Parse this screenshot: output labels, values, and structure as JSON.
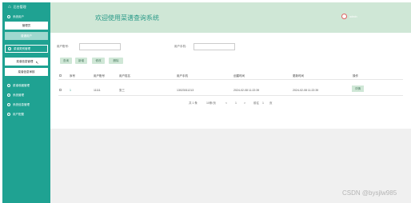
{
  "sidebar": {
    "brand": "后台管理",
    "items": [
      {
        "label": "系统用户",
        "type": "group"
      },
      {
        "label": "管理员",
        "type": "sub-white"
      },
      {
        "label": "普通用户",
        "type": "sub-active"
      },
      {
        "label": "菜谱类别管理",
        "type": "group-box"
      },
      {
        "label": "菜谱信息管理",
        "type": "sub-white"
      },
      {
        "label": "菜谱信息审核",
        "type": "sub-white"
      },
      {
        "label": "菜谱收藏管理",
        "type": "group"
      },
      {
        "label": "系统管理",
        "type": "group"
      },
      {
        "label": "系统信息管理",
        "type": "group"
      },
      {
        "label": "用户配置",
        "type": "group"
      }
    ]
  },
  "header": {
    "title": "欢迎使用菜谱查询系统",
    "user": "admin"
  },
  "filters": {
    "account_label": "用户账号:",
    "phone_label": "用户手机:"
  },
  "toolbar": {
    "query": "查询",
    "add": "新增",
    "edit": "修改",
    "delete": "删除"
  },
  "table": {
    "headers": [
      "序号",
      "用户账号",
      "用户姓名",
      "用户手机",
      "创建时间",
      "更新时间",
      "操作"
    ],
    "rows": [
      [
        "1",
        "11111",
        "张三",
        "13023011213",
        "2024-02-08 11:22:39",
        "2024-02-08 11:22:39",
        "详情"
      ]
    ]
  },
  "pagination": {
    "total": "共 1 条",
    "page_size": "10条/页",
    "prev": "<",
    "current": "1",
    "next": ">",
    "goto": "前往",
    "goto_value": "1",
    "page_unit": "页"
  },
  "watermark": "CSDN @bysjlw985"
}
